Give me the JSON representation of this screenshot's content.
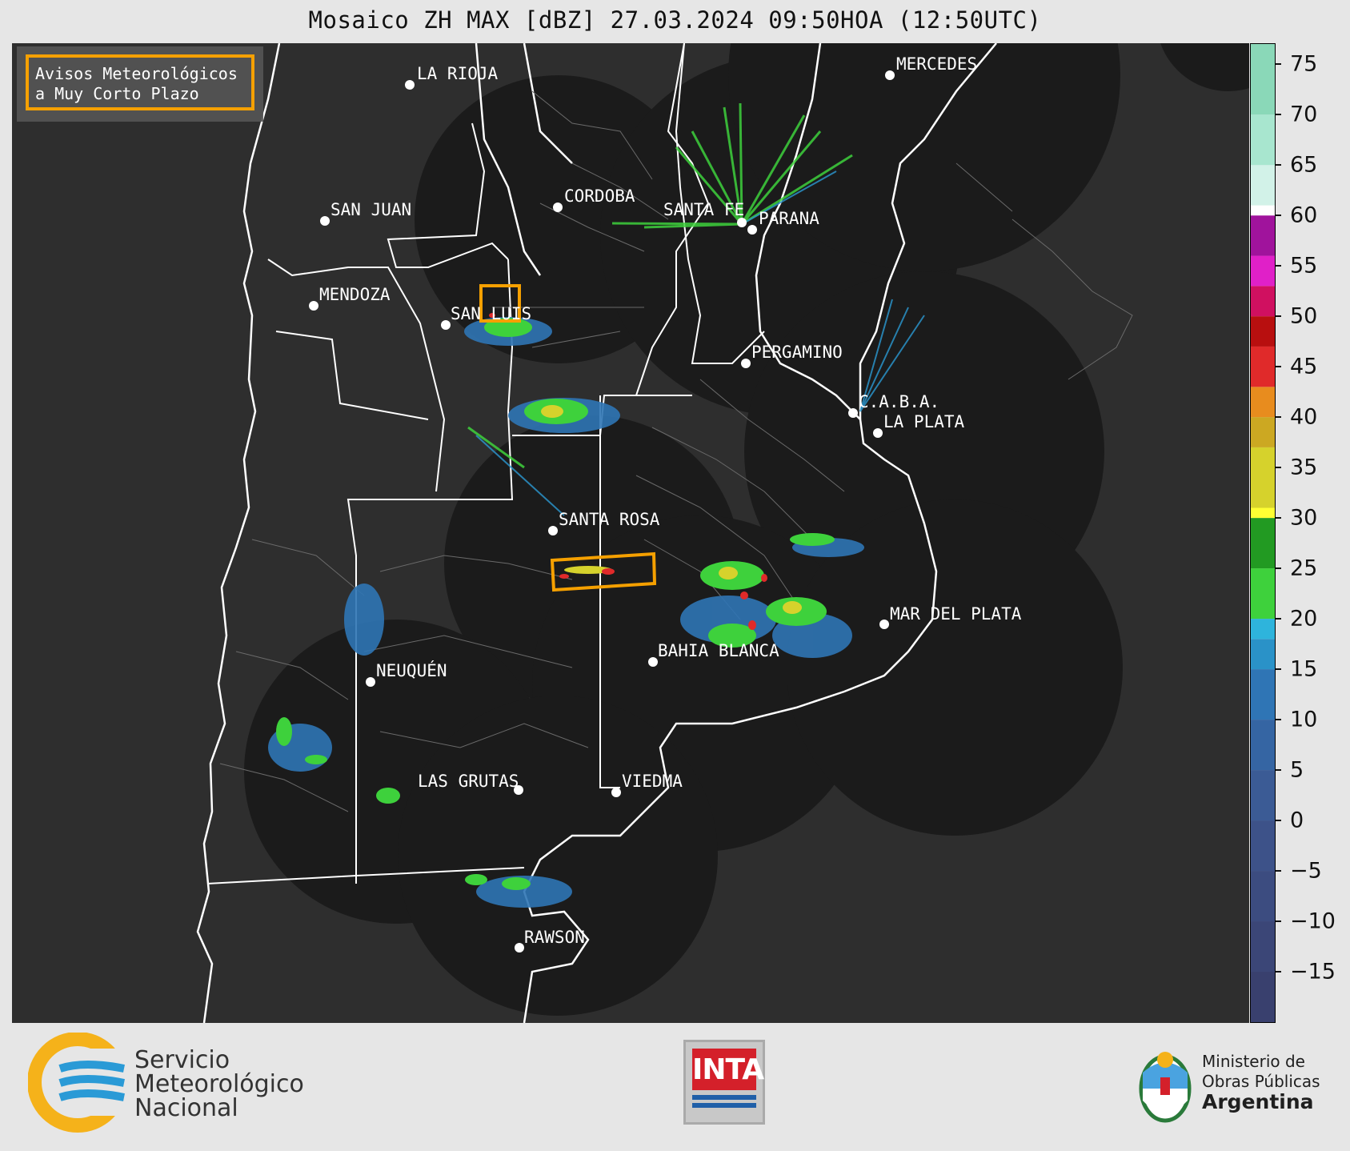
{
  "title": "Mosaico ZH MAX [dBZ] 27.03.2024 09:50HOA (12:50UTC)",
  "alert_legend": {
    "line1": "Avisos Meteorológicos",
    "line2": "a Muy Corto Plazo",
    "color": "#f5a000"
  },
  "cities": [
    {
      "name": "LA RIOJA"
    },
    {
      "name": "MERCEDES"
    },
    {
      "name": "CORDOBA"
    },
    {
      "name": "SAN JUAN"
    },
    {
      "name": "SANTA FE"
    },
    {
      "name": "PARANA"
    },
    {
      "name": "MENDOZA"
    },
    {
      "name": "SAN LUIS"
    },
    {
      "name": "PERGAMINO"
    },
    {
      "name": "C.A.B.A."
    },
    {
      "name": "LA PLATA"
    },
    {
      "name": "SANTA ROSA"
    },
    {
      "name": "MAR DEL PLATA"
    },
    {
      "name": "BAHIA BLANCA"
    },
    {
      "name": "NEUQUÉN"
    },
    {
      "name": "LAS GRUTAS"
    },
    {
      "name": "VIEDMA"
    },
    {
      "name": "RAWSON"
    }
  ],
  "colorbar": {
    "unit": "dBZ",
    "min": -20,
    "max": 77,
    "ticks": [
      75,
      70,
      65,
      60,
      55,
      50,
      45,
      40,
      35,
      30,
      25,
      20,
      15,
      10,
      5,
      0,
      -5,
      -10,
      -15
    ],
    "tick_labels": [
      "75",
      "70",
      "65",
      "60",
      "55",
      "50",
      "45",
      "40",
      "35",
      "30",
      "25",
      "20",
      "15",
      "10",
      "5",
      "0",
      "−5",
      "−10",
      "−15"
    ],
    "bands": [
      {
        "from": -20,
        "to": -15,
        "color": "#39406e"
      },
      {
        "from": -15,
        "to": -10,
        "color": "#3b4677"
      },
      {
        "from": -10,
        "to": -5,
        "color": "#3c4c80"
      },
      {
        "from": -5,
        "to": 0,
        "color": "#3d5289"
      },
      {
        "from": 0,
        "to": 5,
        "color": "#3b5b95"
      },
      {
        "from": 5,
        "to": 10,
        "color": "#3565a3"
      },
      {
        "from": 10,
        "to": 15,
        "color": "#2f75b5"
      },
      {
        "from": 15,
        "to": 18,
        "color": "#2a92c8"
      },
      {
        "from": 18,
        "to": 20,
        "color": "#2eb4dc"
      },
      {
        "from": 20,
        "to": 25,
        "color": "#3ed13c"
      },
      {
        "from": 25,
        "to": 30,
        "color": "#229a22"
      },
      {
        "from": 30,
        "to": 31,
        "color": "#ffff33"
      },
      {
        "from": 31,
        "to": 37,
        "color": "#d6d22c"
      },
      {
        "from": 37,
        "to": 40,
        "color": "#cca822"
      },
      {
        "from": 40,
        "to": 43,
        "color": "#e88c1e"
      },
      {
        "from": 43,
        "to": 47,
        "color": "#e02a2a"
      },
      {
        "from": 47,
        "to": 50,
        "color": "#b80f0f"
      },
      {
        "from": 50,
        "to": 53,
        "color": "#d01060"
      },
      {
        "from": 53,
        "to": 56,
        "color": "#e020c8"
      },
      {
        "from": 56,
        "to": 60,
        "color": "#a0139c"
      },
      {
        "from": 60,
        "to": 61,
        "color": "#ffffff"
      },
      {
        "from": 61,
        "to": 65,
        "color": "#d2f2e8"
      },
      {
        "from": 65,
        "to": 70,
        "color": "#a8e6cf"
      },
      {
        "from": 70,
        "to": 77,
        "color": "#8ad8b8"
      }
    ]
  },
  "footer": {
    "smn_line1": "Servicio",
    "smn_line2": "Meteorológico",
    "smn_line3": "Nacional",
    "inta": "INTA",
    "ministry_line1": "Ministerio de",
    "ministry_line2": "Obras Públicas",
    "ministry_line3": "Argentina"
  },
  "colors": {
    "map_background": "#2e2e2e",
    "radar_disc": "#1b1b1b",
    "province_borders": "#ffffff",
    "alert_box": "#f5a000"
  }
}
